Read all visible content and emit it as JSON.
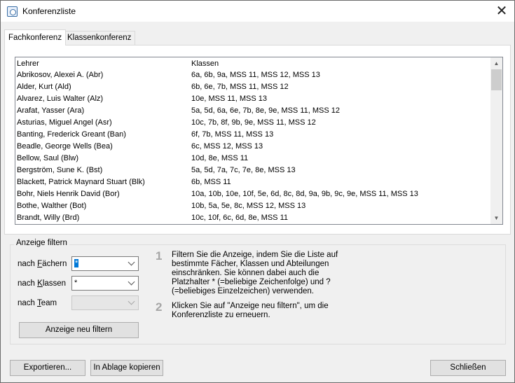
{
  "window": {
    "title": "Konferenzliste",
    "close_symbol": "✕"
  },
  "tabs": [
    {
      "label": "Fachkonferenz",
      "active": true
    },
    {
      "label": "Klassenkonferenz",
      "active": false
    }
  ],
  "list": {
    "columns": [
      "Lehrer",
      "Klassen"
    ],
    "rows": [
      {
        "teacher": "Abrikosov, Alexei A. (Abr)",
        "classes": "6a, 6b, 9a, MSS 11, MSS 12, MSS 13"
      },
      {
        "teacher": "Alder, Kurt (Ald)",
        "classes": "6b, 6e, 7b, MSS 11, MSS 12"
      },
      {
        "teacher": "Alvarez, Luis Walter (Alz)",
        "classes": "10e, MSS 11, MSS 13"
      },
      {
        "teacher": "Arafat, Yasser (Ara)",
        "classes": "5a, 5d, 6a, 6e, 7b, 8e, 9e, MSS 11, MSS 12"
      },
      {
        "teacher": "Asturias, Miguel Angel (Asr)",
        "classes": "10c, 7b, 8f, 9b, 9e, MSS 11, MSS 12"
      },
      {
        "teacher": "Banting, Frederick Greant (Ban)",
        "classes": "6f, 7b, MSS 11, MSS 13"
      },
      {
        "teacher": "Beadle, George Wells (Bea)",
        "classes": "6c, MSS 12, MSS 13"
      },
      {
        "teacher": "Bellow, Saul (Blw)",
        "classes": "10d, 8e, MSS 11"
      },
      {
        "teacher": "Bergström, Sune K. (Bst)",
        "classes": "5a, 5d, 7a, 7c, 7e, 8e, MSS 13"
      },
      {
        "teacher": "Blackett, Patrick Maynard Stuart (Blk)",
        "classes": "6b, MSS 11"
      },
      {
        "teacher": "Bohr, Niels Henrik David (Bor)",
        "classes": "10a, 10b, 10e, 10f, 5e, 6d, 8c, 8d, 9a, 9b, 9c, 9e, MSS 11, MSS 13"
      },
      {
        "teacher": "Bothe, Walther (Bot)",
        "classes": "10b, 5a, 5e, 8c, MSS 12, MSS 13"
      },
      {
        "teacher": "Brandt, Willy (Brd)",
        "classes": "10c, 10f, 6c, 6d, 8e, MSS 11"
      }
    ]
  },
  "filter": {
    "legend": "Anzeige filtern",
    "subjects": {
      "label_pre": "nach ",
      "label_key": "F",
      "label_post": "ächern",
      "value": "*"
    },
    "classes": {
      "label_pre": "nach ",
      "label_key": "K",
      "label_post": "lassen",
      "value": "*"
    },
    "team": {
      "label_pre": "nach ",
      "label_key": "T",
      "label_post": "eam",
      "value": ""
    },
    "apply_label": "Anzeige neu filtern",
    "steps": [
      {
        "num": "1",
        "text": "Filtern Sie die Anzeige, indem Sie die Liste auf bestimmte Fächer, Klassen und Abteilungen einschränken. Sie können dabei auch die Platzhalter * (=beliebige Zeichenfolge) und ? (=beliebiges Einzelzeichen) verwenden."
      },
      {
        "num": "2",
        "text": "Klicken Sie auf \"Anzeige neu filtern\", um die Konferenzliste zu erneuern."
      }
    ]
  },
  "footer": {
    "export_label": "Exportieren...",
    "clipboard_label": "In Ablage kopieren",
    "close_label": "Schließen"
  }
}
